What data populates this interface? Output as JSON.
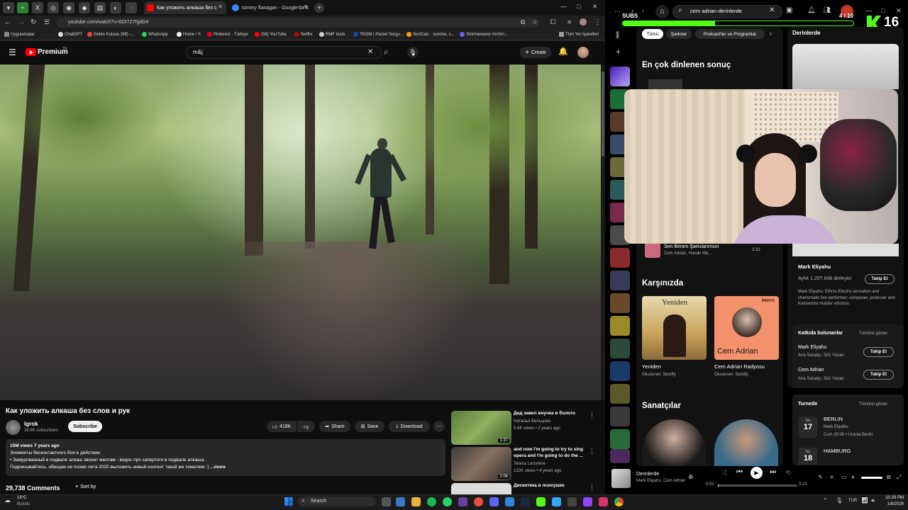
{
  "browser": {
    "tabs": [
      {
        "title": "Как уложить алкаша без с",
        "active": true
      },
      {
        "title": "tommy flanagan - Google'da A",
        "active": false
      }
    ],
    "url": "youtube.com/watch?v=6Dt7Z7fgdD4",
    "bookmarks": [
      "Uygulamalar",
      "ChatGPT",
      "Gelen Kutusu (98) -...",
      "WhatsApp",
      "Home / X",
      "Pinterest - Türkiye",
      "(58) YouTube",
      "Netflix",
      "RMF tests",
      "TKGM | Parsel Sorgu...",
      "SunCalc - sunrise, s...",
      "Stormweaver Archm...",
      "Tüm Yer İşaretleri"
    ]
  },
  "youtube": {
    "logo": "Premium",
    "logo_sup": "TR",
    "search_value": "m&j",
    "create": "Create",
    "video_title": "Как уложить алкаша без слов и рук",
    "channel": "lgrok",
    "subscribers": "39.9K subscribers",
    "subscribe": "Subscribe",
    "likes": "418K",
    "share": "Share",
    "save": "Save",
    "download": "Download",
    "views": "15M views  7 years ago",
    "desc1": "Элементы бесконтактного боя в действии.",
    "desc2": "• Замурованный в подвале алкаш звонит ментам  - видос про запертого в подвале алкаша.",
    "desc3": "Подписывайтесь, обещаю не позже лета 2020 выложить новый контент такой же тематики :) ",
    "more": "...more",
    "comments": "29,738 Comments",
    "sort": "Sort by",
    "related": [
      {
        "title": "Дед завел внучка в болото",
        "channel": "Наталья Бельцова",
        "meta": "5.6K views • 2 years ago",
        "duration": "1:37"
      },
      {
        "title": "and now I'm going to try to sing opera and I'm going to do the ...",
        "channel": "Teresa Larzelere",
        "meta": "122K views • 4 years ago",
        "duration": "2:06"
      },
      {
        "title": "Дискотека в психушке",
        "channel": "",
        "meta": "",
        "duration": ""
      }
    ]
  },
  "spotify": {
    "search_value": "cem adrian-derinlerde",
    "subs_label": "SUBS",
    "subs_count": "4 / 10",
    "kick_count": "16",
    "filters": [
      "Tümü",
      "Şarkılar",
      "Podcast'ler ve Programlar"
    ],
    "top_result_heading": "En çok dinlenen sonuç",
    "right_title": "Derinlerde",
    "song": {
      "title": "Sen Benim Şarkılarımsın",
      "artists": "Cem Adrian, Hande Me...",
      "duration": "3:32"
    },
    "karsinizda": "Karşınızda",
    "cards": [
      {
        "title": "Yeniden",
        "sub": "Oluşturan: Spotify",
        "cover_text": "Yeniden"
      },
      {
        "title": "Cem Adrian Radyosu",
        "sub": "Oluşturan: Spotify",
        "cover_text": "Cem Adrian",
        "badge": "RADYO"
      }
    ],
    "sanatcilar": "Sanatçılar",
    "artist": {
      "name": "Mark Eliyahu",
      "listeners": "Aylık 1.207.648 dinleyici",
      "follow": "Takip Et",
      "bio": "Mark Eliyahu: Ethnic-Electro sensation and charismatic live performer; composer, producer and Kamanche master virtuoso."
    },
    "credits_heading": "Katkıda bulunanlar",
    "show_all": "Tümünü göster",
    "credits": [
      {
        "name": "Mark Eliyahu",
        "role": "Ana Sanatçı, Söz Yazarı",
        "follow": "Takip Et"
      },
      {
        "name": "Cem Adrian",
        "role": "Ana Sanatçı, Söz Yazarı",
        "follow": "Takip Et"
      }
    ],
    "tour_heading": "Turnede",
    "tour": [
      {
        "city": "BERLIN",
        "month": "Nis",
        "day": "17",
        "artist": "Mark Eliyahu",
        "detail": "Cum 20:00 • Urania Berlin"
      },
      {
        "city": "HAMBURG",
        "month": "Nis",
        "day": "18",
        "artist": "",
        "detail": ""
      }
    ],
    "player": {
      "title": "Derinlerde",
      "artists": "Mark Eliyahu, Cem Adrian",
      "elapsed": "0:01",
      "total": "3:21",
      "progress": 0.01
    }
  },
  "taskbar": {
    "weather_temp": "13°C",
    "weather_desc": "Bulutlu",
    "search": "Search",
    "lang": "TUR",
    "time": "10:39 PM",
    "date": "1/8/2026"
  }
}
